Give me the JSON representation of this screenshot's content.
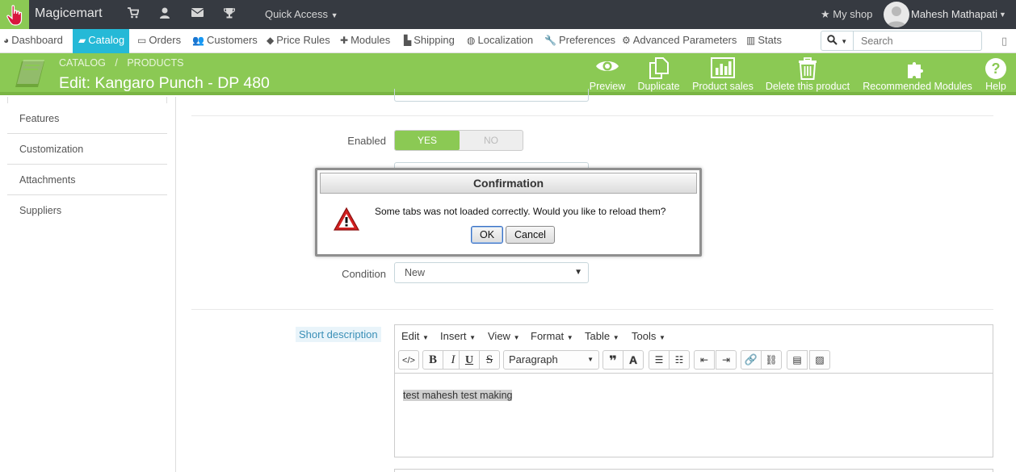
{
  "topbar": {
    "shop_name": "Magicemart",
    "quick_access": "Quick Access",
    "my_shop": "My shop",
    "user_name": "Mahesh Mathapati"
  },
  "menu": {
    "items": [
      {
        "label": "Dashboard",
        "icon": "dashboard-icon"
      },
      {
        "label": "Catalog",
        "icon": "book-icon",
        "active": true
      },
      {
        "label": "Orders",
        "icon": "credit-card-icon"
      },
      {
        "label": "Customers",
        "icon": "users-icon"
      },
      {
        "label": "Price Rules",
        "icon": "tag-icon"
      },
      {
        "label": "Modules",
        "icon": "puzzle-icon"
      },
      {
        "label": "Shipping",
        "icon": "truck-icon"
      },
      {
        "label": "Localization",
        "icon": "globe-icon"
      },
      {
        "label": "Preferences",
        "icon": "wrench-icon"
      },
      {
        "label": "Advanced Parameters",
        "icon": "cogs-icon"
      },
      {
        "label": "Stats",
        "icon": "bar-chart-icon"
      }
    ],
    "search_placeholder": "Search"
  },
  "toolbar": {
    "breadcrumb_1": "CATALOG",
    "breadcrumb_sep": "/",
    "breadcrumb_2": "PRODUCTS",
    "title": "Edit: Kangaro Punch - DP 480",
    "buttons": {
      "preview": "Preview",
      "duplicate": "Duplicate",
      "product_sales": "Product sales",
      "delete": "Delete this product",
      "recommended": "Recommended Modules",
      "help": "Help"
    },
    "accent_color": "#8bc954"
  },
  "sidebar": {
    "items": [
      "Features",
      "Customization",
      "Attachments",
      "Suppliers"
    ]
  },
  "form": {
    "enabled_label": "Enabled",
    "yes": "YES",
    "no": "NO",
    "condition_label": "Condition",
    "condition_value": "New",
    "short_desc_label": "Short description"
  },
  "editor": {
    "menus": [
      "Edit",
      "Insert",
      "View",
      "Format",
      "Table",
      "Tools"
    ],
    "paragraph": "Paragraph",
    "content": "test mahesh test making"
  },
  "dialog": {
    "title": "Confirmation",
    "message": "Some tabs was not loaded correctly. Would you like to reload them?",
    "ok": "OK",
    "cancel": "Cancel"
  }
}
